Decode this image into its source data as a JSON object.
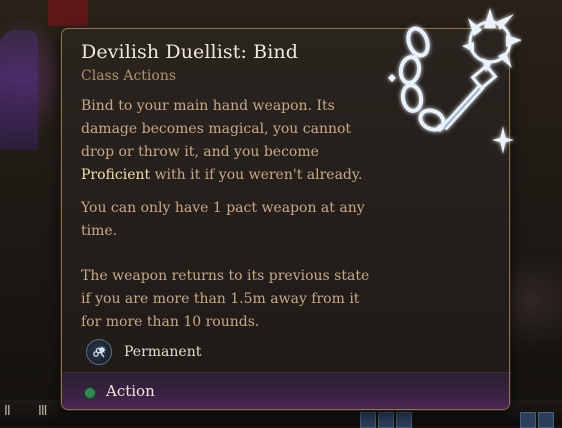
{
  "tooltip": {
    "title": "Devilish Duellist: Bind",
    "subtitle": "Class Actions",
    "description": {
      "p1_before": "Bind to your main hand weapon. Its damage becomes magical, you cannot drop or throw it, and you become ",
      "p1_highlight": "Proficient",
      "p1_after": " with it if you weren't already.",
      "p2": "You can only have 1 pact weapon at any time.",
      "p3": "The weapon returns to its previous state if you are more than 1.5m away from it for more than 10 rounds."
    },
    "duration": {
      "label": "Permanent",
      "icon": "pact-weapon-icon"
    },
    "footer": {
      "action_label": "Action",
      "action_color": "#2f8a4d"
    },
    "spell_icon": "chained-mace-icon"
  },
  "hotbar": {
    "icons": [
      "II",
      "III"
    ]
  },
  "colors": {
    "border": "#8d7149",
    "title": "#f1ead9",
    "subtitle": "#b4926a",
    "body": "#c8a987",
    "highlight": "#f2e1a6",
    "footer": "#4a2656"
  }
}
